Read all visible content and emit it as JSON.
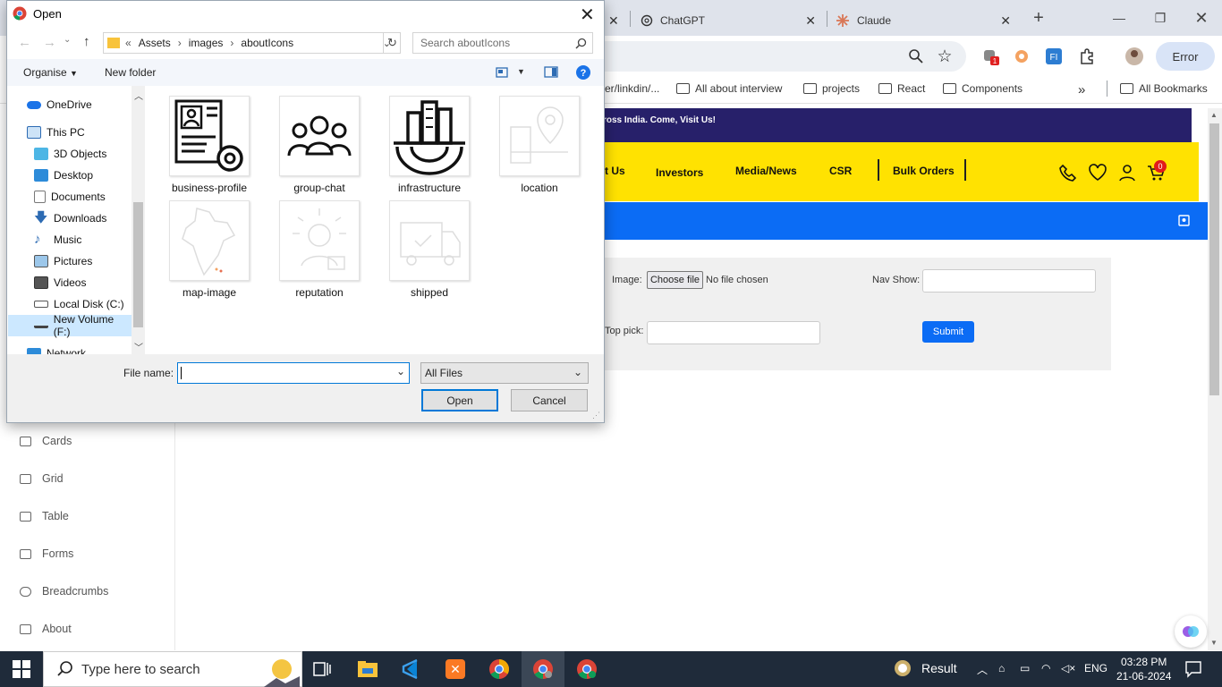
{
  "browser": {
    "tabs": [
      {
        "label": "ChatGPT",
        "icon": "chatgpt-icon"
      },
      {
        "label": "Claude",
        "icon": "claude-icon"
      }
    ],
    "error_label": "Error",
    "bookmarks": [
      "er/linkdin/...",
      "All about interview",
      "projects",
      "React",
      "Components"
    ],
    "all_bookmarks": "All Bookmarks"
  },
  "site": {
    "promo": "ross India. Come, Visit Us!",
    "nav": [
      "t Us",
      "Investors",
      "Media/News",
      "CSR",
      "Bulk Orders"
    ],
    "cart_count": "0",
    "colors": {
      "promo": "#27206a",
      "nav": "#ffe201",
      "blue": "#0b6cf5"
    }
  },
  "form": {
    "image_label": "Image:",
    "choose_file": "Choose file",
    "no_file": "No file chosen",
    "nav_show_label": "Nav Show:",
    "top_pick_label": "Top pick:",
    "submit": "Submit"
  },
  "sidebar": {
    "items": [
      "Cards",
      "Grid",
      "Table",
      "Forms",
      "Breadcrumbs",
      "About"
    ]
  },
  "dialog": {
    "title": "Open",
    "breadcrumb": [
      "Assets",
      "images",
      "aboutIcons"
    ],
    "search_placeholder": "Search aboutIcons",
    "organise": "Organise",
    "new_folder": "New folder",
    "nav_items": [
      {
        "label": "OneDrive",
        "icon": "onedrive-icon"
      },
      {
        "label": "This PC",
        "icon": "computer-icon"
      },
      {
        "label": "3D Objects",
        "icon": "3d-objects-icon"
      },
      {
        "label": "Desktop",
        "icon": "desktop-icon"
      },
      {
        "label": "Documents",
        "icon": "documents-icon"
      },
      {
        "label": "Downloads",
        "icon": "downloads-icon"
      },
      {
        "label": "Music",
        "icon": "music-icon"
      },
      {
        "label": "Pictures",
        "icon": "pictures-icon"
      },
      {
        "label": "Videos",
        "icon": "videos-icon"
      },
      {
        "label": "Local Disk (C:)",
        "icon": "drive-icon"
      },
      {
        "label": "New Volume (F:)",
        "icon": "drive-icon"
      },
      {
        "label": "Network",
        "icon": "network-icon"
      }
    ],
    "files": [
      {
        "name": "business-profile",
        "icon": "business-profile-icon"
      },
      {
        "name": "group-chat",
        "icon": "group-chat-icon"
      },
      {
        "name": "infrastructure",
        "icon": "infrastructure-icon"
      },
      {
        "name": "location",
        "icon": "location-icon"
      },
      {
        "name": "map-image",
        "icon": "map-image-icon"
      },
      {
        "name": "reputation",
        "icon": "reputation-icon"
      },
      {
        "name": "shipped",
        "icon": "shipped-icon"
      }
    ],
    "file_name_label": "File name:",
    "file_name_value": "",
    "file_type": "All Files",
    "open_button": "Open",
    "cancel_button": "Cancel"
  },
  "taskbar": {
    "search_placeholder": "Type here to search",
    "weather_label": "Result",
    "language": "ENG",
    "time": "03:28 PM",
    "date": "21-06-2024"
  }
}
